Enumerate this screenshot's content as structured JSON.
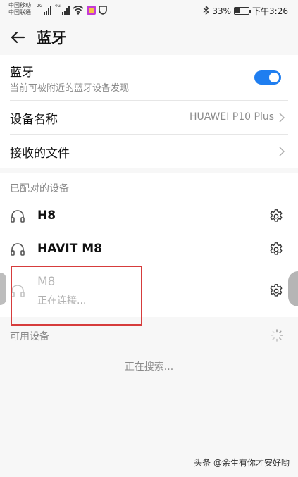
{
  "status_bar": {
    "carrier_1": "中国移动",
    "carrier_2": "中国联通",
    "signal_1_label": "2G",
    "signal_2_label": "4G",
    "battery_percent": "33%",
    "battery_level": 0.33,
    "time": "下午3:26",
    "icons": [
      "signal-icon",
      "wifi-icon",
      "app-icon",
      "shield-icon",
      "bluetooth-icon",
      "battery-icon"
    ]
  },
  "header": {
    "title": "蓝牙"
  },
  "bluetooth_row": {
    "title": "蓝牙",
    "subtitle": "当前可被附近的蓝牙设备发现",
    "toggle_on": true
  },
  "device_name_row": {
    "label": "设备名称",
    "value": "HUAWEI P10 Plus"
  },
  "received_files_row": {
    "label": "接收的文件"
  },
  "paired": {
    "section_label": "已配对的设备",
    "devices": [
      {
        "name": "H8",
        "status": ""
      },
      {
        "name": "HAVIT M8",
        "status": ""
      },
      {
        "name": "M8",
        "status": "正在连接..."
      }
    ]
  },
  "available": {
    "section_label": "可用设备",
    "searching_text": "正在搜索..."
  },
  "watermark": "头条 @余生有你才安好哟",
  "colors": {
    "accent": "#1f7ef0",
    "highlight_box": "#d63c3c",
    "secondary_text": "#8a8a8a"
  }
}
